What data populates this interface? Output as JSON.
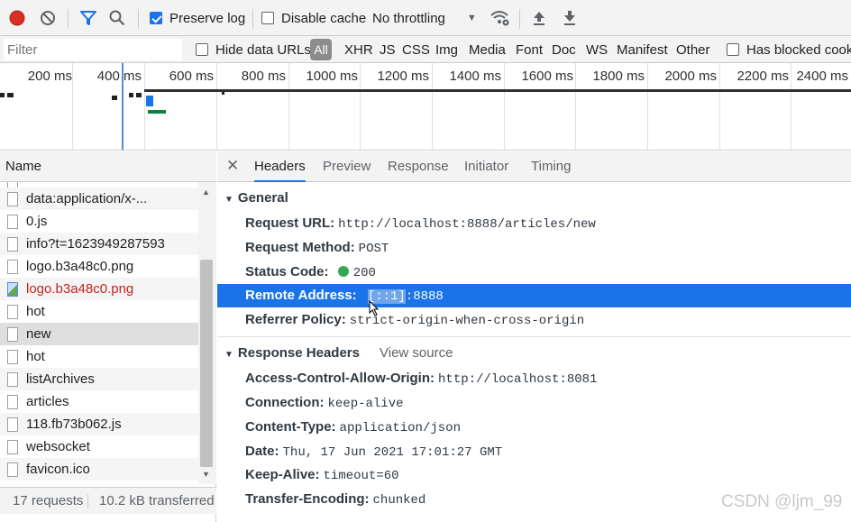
{
  "toolbar": {
    "preserve_log": "Preserve log",
    "disable_cache": "Disable cache",
    "throttling": "No throttling"
  },
  "filterbar": {
    "filter_placeholder": "Filter",
    "hide_data_urls": "Hide data URLs",
    "types": [
      "All",
      "XHR",
      "JS",
      "CSS",
      "Img",
      "Media",
      "Font",
      "Doc",
      "WS",
      "Manifest",
      "Other"
    ],
    "has_blocked_cookies": "Has blocked cooki"
  },
  "overview": {
    "ticks": [
      "200 ms",
      "400 ms",
      "600 ms",
      "800 ms",
      "1000 ms",
      "1200 ms",
      "1400 ms",
      "1600 ms",
      "1800 ms",
      "2000 ms",
      "2200 ms",
      "2400 ms"
    ]
  },
  "requests": {
    "header": "Name",
    "items": [
      {
        "name": "data:application/x-..."
      },
      {
        "name": "0.js"
      },
      {
        "name": "info?t=1623949287593"
      },
      {
        "name": "logo.b3a48c0.png"
      },
      {
        "name": "logo.b3a48c0.png"
      },
      {
        "name": "hot"
      },
      {
        "name": "new"
      },
      {
        "name": "hot"
      },
      {
        "name": "listArchives"
      },
      {
        "name": "articles"
      },
      {
        "name": "118.fb73b062.js"
      },
      {
        "name": "websocket"
      },
      {
        "name": "favicon.ico"
      }
    ],
    "footer_requests": "17 requests",
    "footer_transferred": "10.2 kB transferred"
  },
  "tabs": [
    "Headers",
    "Preview",
    "Response",
    "Initiator",
    "Timing"
  ],
  "general": {
    "title": "General",
    "request_url_key": "Request URL:",
    "request_url": "http://localhost:8888/articles/new",
    "request_method_key": "Request Method:",
    "request_method": "POST",
    "status_code_key": "Status Code:",
    "status_code": "200",
    "remote_address_key": "Remote Address:",
    "remote_address_sel": "[::1]",
    "remote_address_rest": ":8888",
    "referrer_policy_key": "Referrer Policy:",
    "referrer_policy": "strict-origin-when-cross-origin"
  },
  "response_headers": {
    "title": "Response Headers",
    "view_source": "View source",
    "items": [
      {
        "key": "Access-Control-Allow-Origin:",
        "value": "http://localhost:8081"
      },
      {
        "key": "Connection:",
        "value": "keep-alive"
      },
      {
        "key": "Content-Type:",
        "value": "application/json"
      },
      {
        "key": "Date:",
        "value": "Thu, 17 Jun 2021 17:01:27 GMT"
      },
      {
        "key": "Keep-Alive:",
        "value": "timeout=60"
      },
      {
        "key": "Transfer-Encoding:",
        "value": "chunked"
      }
    ]
  },
  "watermark": "CSDN @ljm_99"
}
